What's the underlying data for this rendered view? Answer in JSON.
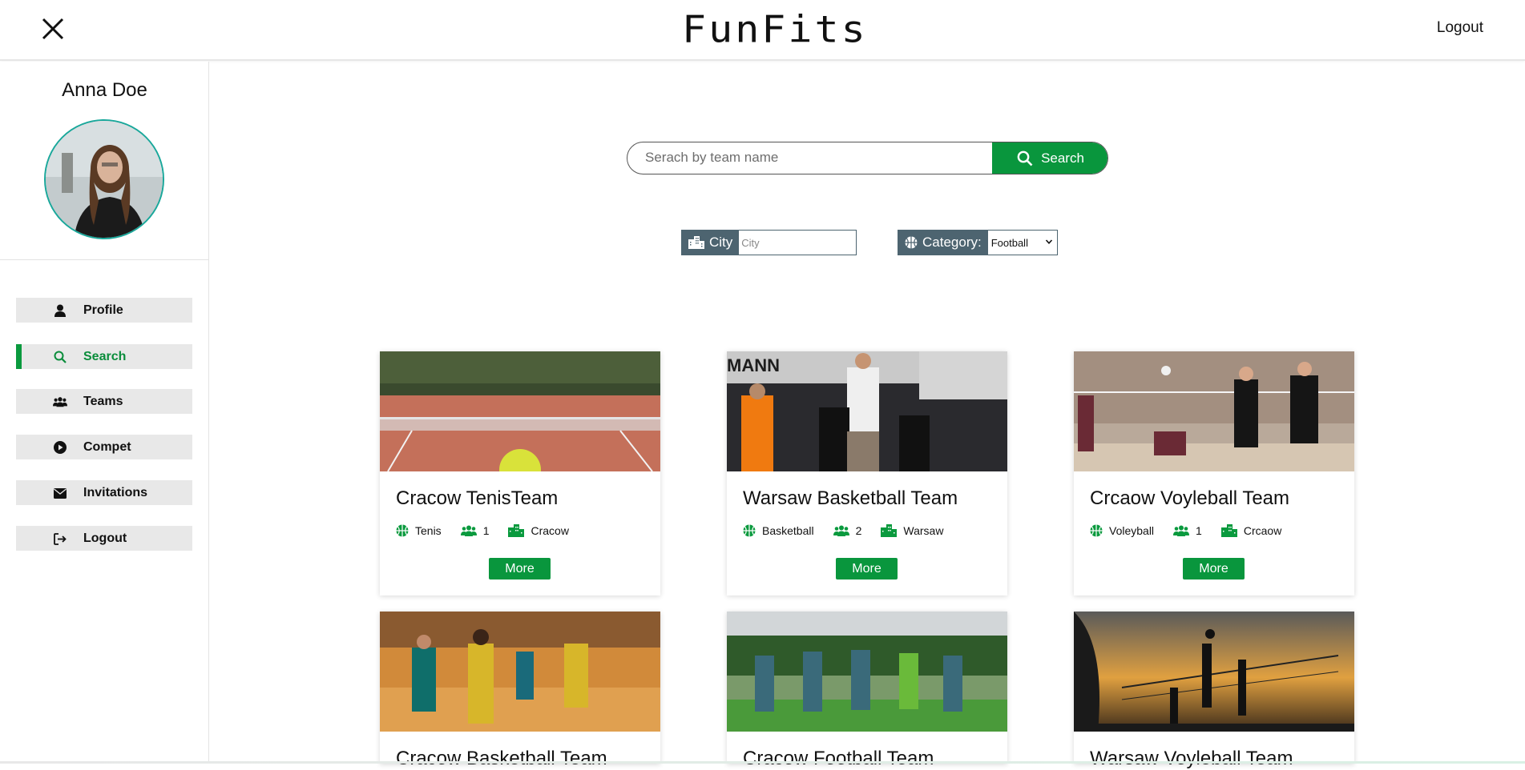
{
  "header": {
    "logo": "FunFits",
    "logout_label": "Logout"
  },
  "sidebar": {
    "user_name": "Anna Doe",
    "items": [
      {
        "label": "Profile",
        "icon": "user-icon",
        "active": false
      },
      {
        "label": "Search",
        "icon": "search-icon",
        "active": true
      },
      {
        "label": "Teams",
        "icon": "users-icon",
        "active": false
      },
      {
        "label": "Compet",
        "icon": "play-circle-icon",
        "active": false
      },
      {
        "label": "Invitations",
        "icon": "envelope-icon",
        "active": false
      },
      {
        "label": "Logout",
        "icon": "logout-icon",
        "active": false
      }
    ]
  },
  "search": {
    "placeholder": "Serach by team name",
    "button_label": "Search"
  },
  "filters": {
    "city_label": "City",
    "city_placeholder": "City",
    "category_label": "Category:",
    "category_selected": "Football"
  },
  "teams": [
    {
      "name": "Cracow TenisTeam",
      "sport": "Tenis",
      "members": "1",
      "city": "Cracow",
      "more_label": "More",
      "image": "tennis-court"
    },
    {
      "name": "Warsaw Basketball Team",
      "sport": "Basketball",
      "members": "2",
      "city": "Warsaw",
      "more_label": "More",
      "image": "basketball-dunk"
    },
    {
      "name": "Crcaow Voyleball Team",
      "sport": "Voleyball",
      "members": "1",
      "city": "Crcaow",
      "more_label": "More",
      "image": "volleyball-indoor"
    },
    {
      "name": "Cracow Basketball Team",
      "image": "basketball-gym"
    },
    {
      "name": "Cracow Football Team",
      "image": "football-players"
    },
    {
      "name": "Warsaw Voyleball Team",
      "image": "volleyball-sunset"
    }
  ],
  "colors": {
    "accent_green": "#09963d",
    "filter_label_bg": "#4d6470",
    "avatar_border": "#19a89b"
  }
}
